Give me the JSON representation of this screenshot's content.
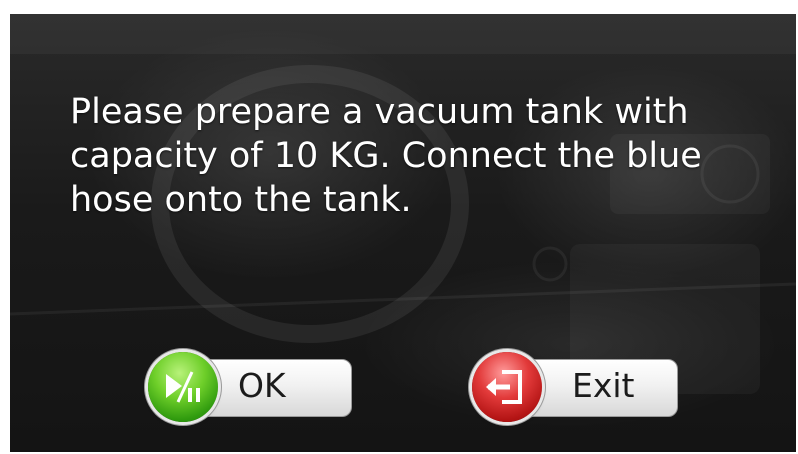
{
  "message": "Please prepare a vacuum tank with capacity of 10 KG. Connect the blue hose onto the tank.",
  "buttons": {
    "ok": {
      "label": "OK",
      "icon": "play-pause-icon",
      "color": "#4fb81a"
    },
    "exit": {
      "label": "Exit",
      "icon": "exit-door-icon",
      "color": "#d02a2a"
    }
  },
  "background": {
    "description_color": "#1a1a1a"
  }
}
